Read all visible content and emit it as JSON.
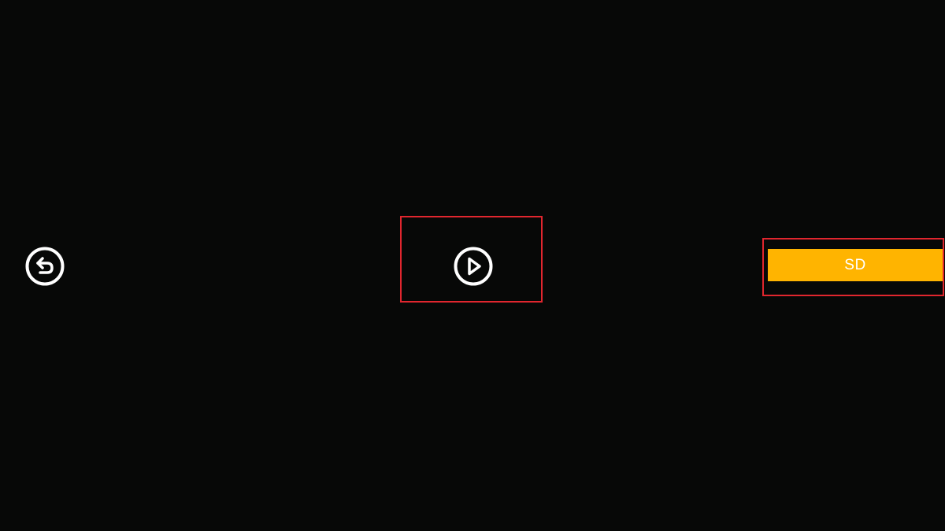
{
  "controls": {
    "back": {
      "icon": "back-arrow-circle-icon"
    },
    "play": {
      "icon": "play-circle-icon"
    },
    "quality": {
      "label": "SD"
    }
  },
  "colors": {
    "background": "#070807",
    "icon": "#ffffff",
    "quality_button": "#ffb400",
    "highlight_border": "#e0262e"
  }
}
